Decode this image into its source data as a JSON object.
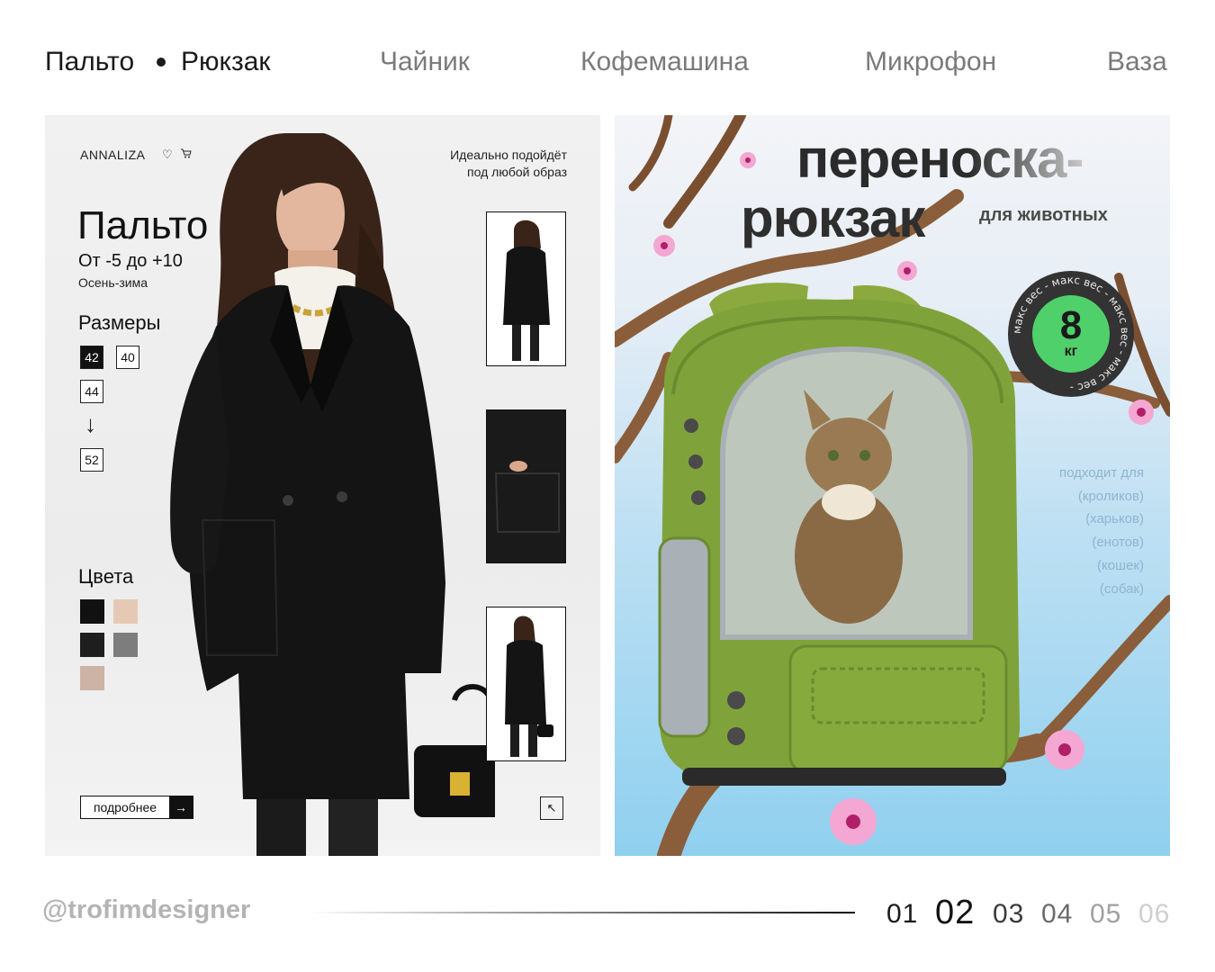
{
  "nav": {
    "tab1": "Пальто",
    "tab2": "Рюкзак",
    "tab3": "Чайник",
    "tab4": "Кофемашина",
    "tab5": "Микрофон",
    "tab6": "Ваза"
  },
  "coat_card": {
    "brand": "ANNALIZA",
    "icons": [
      "heart-icon",
      "cart-icon"
    ],
    "tagline_line1": "Идеально подойдёт",
    "tagline_line2": "под любой образ",
    "title": "Пальто",
    "temperature": "От -5 до +10",
    "season": "Осень-зима",
    "sizes_heading": "Размеры",
    "sizes": [
      "42",
      "40",
      "44",
      "52"
    ],
    "selected_size": "42",
    "colors_heading": "Цвета",
    "colors": [
      "#111111",
      "#e6c9b5",
      "#1e1e1e",
      "#7d7d7d",
      "#cdb2a6"
    ],
    "more_label": "подробнее",
    "more_arrow": "→",
    "corner_arrow": "↖"
  },
  "backpack_card": {
    "headline_line1": "переноска-",
    "headline_line2": "рюкзак",
    "subtitle": "для животных",
    "badge_number": "8",
    "badge_unit": "кг",
    "badge_ring_text": "макс вес - макс вес - макс вес - макс вес -",
    "suits_heading": "подходит для",
    "suits": [
      "(кроликов)",
      "(харьков)",
      "(енотов)",
      "(кошек)",
      "(собак)"
    ]
  },
  "footer": {
    "handle": "@trofimdesigner",
    "pages": [
      "01",
      "02",
      "03",
      "04",
      "05",
      "06"
    ],
    "current_page": "02"
  }
}
